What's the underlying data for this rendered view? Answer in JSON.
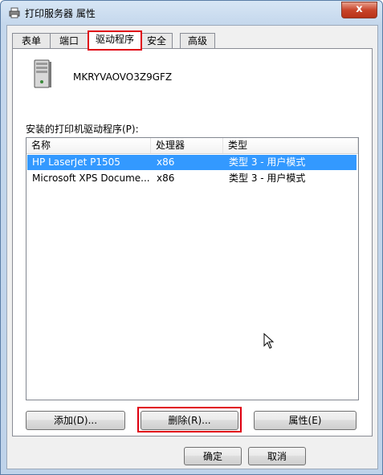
{
  "window": {
    "title": "打印服务器 属性",
    "close_symbol": "x"
  },
  "tabs": [
    {
      "label": "表单",
      "active": false
    },
    {
      "label": "端口",
      "active": false
    },
    {
      "label": "驱动程序",
      "active": true
    },
    {
      "label": "安全",
      "active": false
    },
    {
      "label": "高级",
      "active": false
    }
  ],
  "server": {
    "name": "MKRYVAOVO3Z9GFZ",
    "icon": "server-icon"
  },
  "drivers": {
    "list_label": "安装的打印机驱动程序(P):",
    "columns": [
      "名称",
      "处理器",
      "类型"
    ],
    "rows": [
      {
        "name": "HP LaserJet P1505",
        "processor": "x86",
        "type": "类型 3 - 用户模式",
        "selected": true
      },
      {
        "name": "Microsoft XPS Docume...",
        "processor": "x86",
        "type": "类型 3 - 用户模式",
        "selected": false
      }
    ]
  },
  "buttons": {
    "add": "添加(D)...",
    "remove": "删除(R)...",
    "properties": "属性(E)",
    "ok": "确定",
    "cancel": "取消"
  },
  "colors": {
    "highlight": "#e00010",
    "selection": "#3399ff"
  }
}
